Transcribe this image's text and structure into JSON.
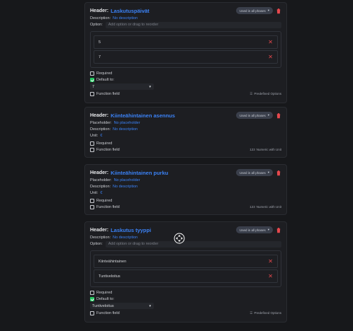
{
  "common": {
    "header_label": "Header:",
    "phase_pill": "Used in all phases",
    "description_key": "Description:",
    "placeholder_key": "Placeholder:",
    "unit_key": "Unit:",
    "option_key": "Option:",
    "option_placeholder": "Add option or drag to reorder",
    "required": "Required",
    "default_to": "Default to:",
    "function_field": "Function field",
    "predefined_options": "Predefined Options",
    "numeric_with_unit": "Numeric with Unit",
    "no_description": "No description",
    "no_placeholder": "No placeholder",
    "colors": {
      "accent": "#3b82f6",
      "danger": "#e5484d",
      "success": "#22c55e"
    }
  },
  "cards": [
    {
      "header": "Laskutuspäivät",
      "options": [
        "5",
        "7"
      ],
      "default_value": "7"
    },
    {
      "header": "Kiinteähintainen asennus",
      "unit": "€"
    },
    {
      "header": "Kiinteähintainen purku",
      "unit": "€"
    },
    {
      "header": "Laskutus tyyppi",
      "options": [
        "Kiinteähintainen",
        "Tuntiveloitus"
      ],
      "default_value": "Tuntiveloitus"
    }
  ],
  "icons": {
    "trash": "trash-icon",
    "close": "close-icon",
    "caret": "chevron-down-icon",
    "list": "list-icon",
    "numeric": "numeric-icon",
    "move": "move-cursor-icon"
  }
}
